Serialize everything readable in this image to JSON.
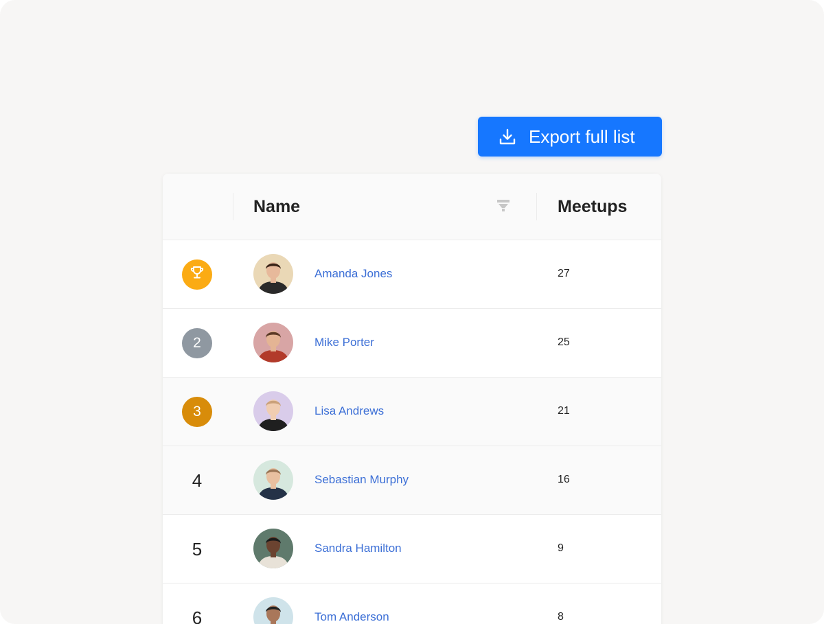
{
  "toolbar": {
    "export_label": "Export full list",
    "export_icon": "download-icon",
    "accent_color": "#1677ff"
  },
  "table": {
    "columns": {
      "name": "Name",
      "meetups": "Meetups",
      "filter_icon": "filter-icon"
    },
    "rows": [
      {
        "rank": "",
        "rank_icon": "trophy-icon",
        "badge_color": "#fbab14",
        "name": "Amanda Jones",
        "meetups": "27",
        "avatar_bg": "#ead8b6",
        "hair": "#3a2418",
        "skin": "#e7b99b",
        "shirt": "#2a2a2a"
      },
      {
        "rank": "2",
        "badge_color": "#8f98a1",
        "name": "Mike Porter",
        "meetups": "25",
        "avatar_bg": "#d8a5a5",
        "hair": "#5b3a26",
        "skin": "#e4b494",
        "shirt": "#b23a2a"
      },
      {
        "rank": "3",
        "badge_color": "#d88c0a",
        "name": "Lisa Andrews",
        "meetups": "21",
        "avatar_bg": "#d9ccea",
        "hair": "#caa17a",
        "skin": "#f0cdb1",
        "shirt": "#1f1f1f"
      },
      {
        "rank": "4",
        "name": "Sebastian Murphy",
        "meetups": "16",
        "avatar_bg": "#d6e8de",
        "hair": "#9b7656",
        "skin": "#e8c0a0",
        "shirt": "#243247"
      },
      {
        "rank": "5",
        "name": "Sandra Hamilton",
        "meetups": "9",
        "avatar_bg": "#5f7a6c",
        "hair": "#1a1a1a",
        "skin": "#6b4330",
        "shirt": "#e8e2d8"
      },
      {
        "rank": "6",
        "name": "Tom Anderson",
        "meetups": "8",
        "avatar_bg": "#cfe3ea",
        "hair": "#222222",
        "skin": "#a9775a",
        "shirt": "#2b3c55"
      }
    ]
  }
}
